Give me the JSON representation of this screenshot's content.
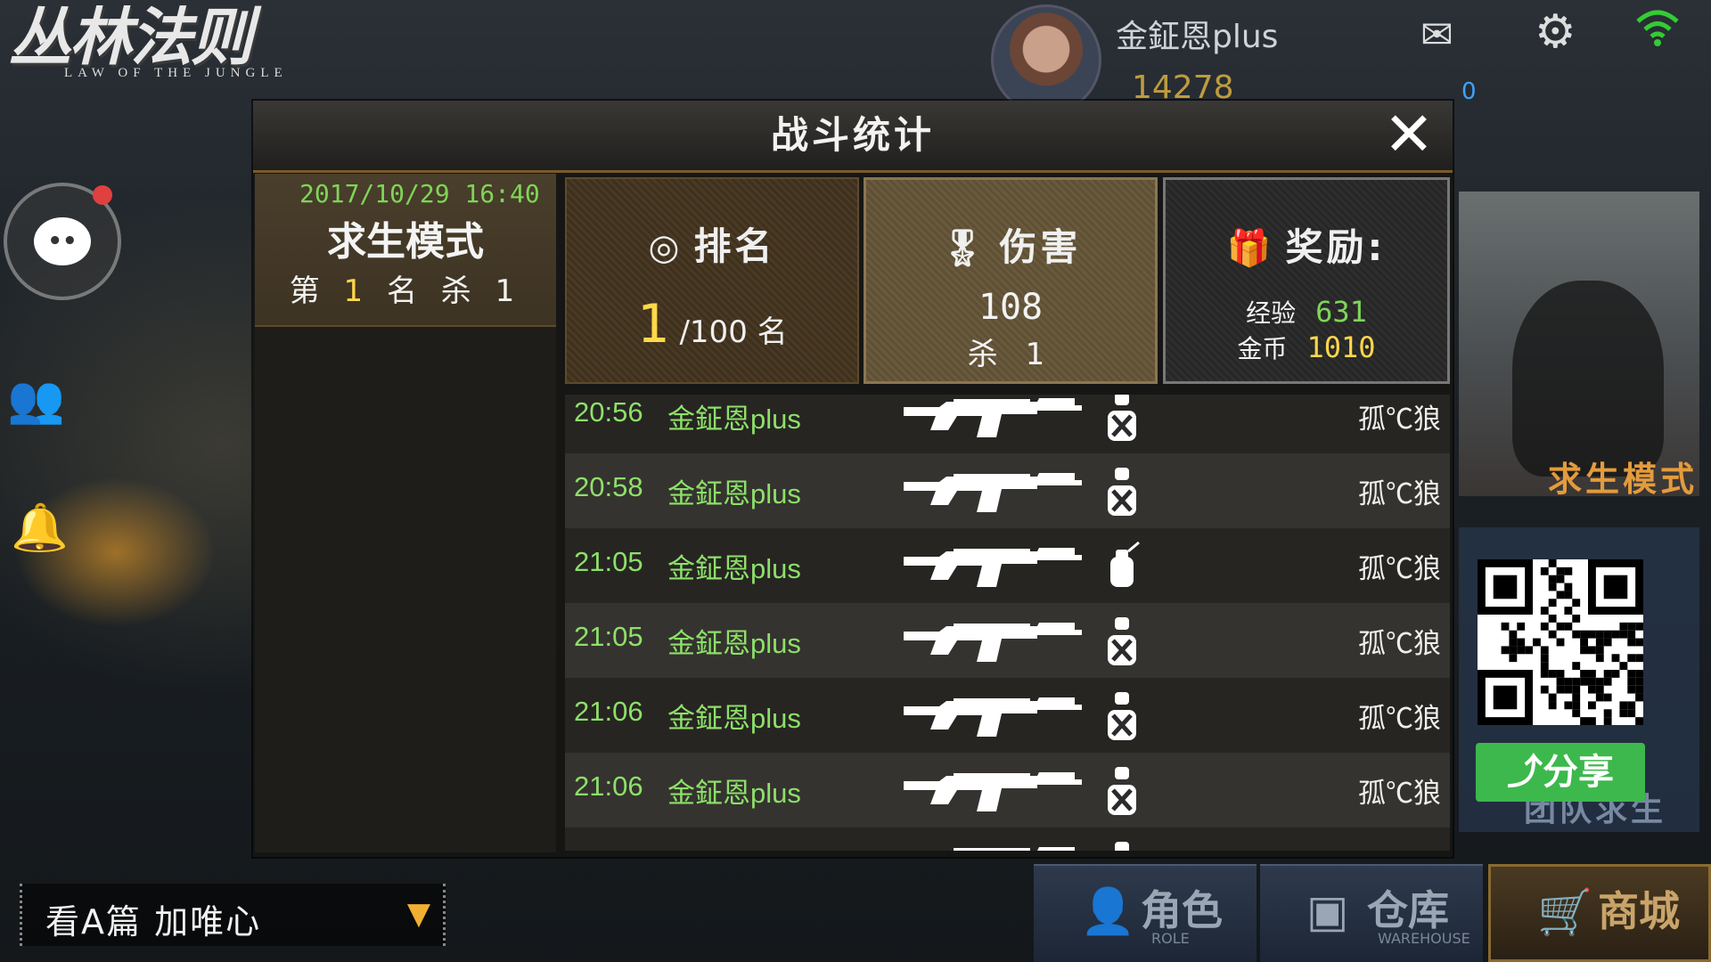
{
  "header": {
    "logo_cn": "丛林法则",
    "logo_en": "LAW OF THE JUNGLE",
    "username": "金鉦恩plus",
    "coins": "14278",
    "diamonds": "0"
  },
  "panel": {
    "title": "战斗统计",
    "close": "✕",
    "session": {
      "datetime": "2017/10/29 16:40",
      "mode": "求生模式",
      "rank_prefix": "第",
      "rank": "1",
      "rank_mid": "名 杀",
      "kills": "1"
    },
    "rank_card": {
      "title": "排名",
      "value": "1",
      "suffix": "/100 名"
    },
    "damage_card": {
      "title": "伤害",
      "damage": "108",
      "kill_label": "杀 1"
    },
    "reward_card": {
      "title": "奖励:",
      "exp_label": "经验",
      "exp_value": "631",
      "gold_label": "金币",
      "gold_value": "1010"
    },
    "kill_feed": [
      {
        "time": "20:56",
        "player": "金鉦恩plus",
        "victim": "孤℃狼",
        "icon": "knockdown-icon"
      },
      {
        "time": "20:58",
        "player": "金鉦恩plus",
        "victim": "孤℃狼",
        "icon": "knockdown-icon"
      },
      {
        "time": "21:05",
        "player": "金鉦恩plus",
        "victim": "孤℃狼",
        "icon": "kill-icon"
      },
      {
        "time": "21:05",
        "player": "金鉦恩plus",
        "victim": "孤℃狼",
        "icon": "knockdown-icon"
      },
      {
        "time": "21:06",
        "player": "金鉦恩plus",
        "victim": "孤℃狼",
        "icon": "knockdown-icon"
      },
      {
        "time": "21:06",
        "player": "金鉦恩plus",
        "victim": "孤℃狼",
        "icon": "knockdown-icon"
      },
      {
        "time": "",
        "player": "",
        "victim": "",
        "icon": "knockdown-icon"
      }
    ]
  },
  "right": {
    "mode_label": "求生模式",
    "team_label": "团队求生",
    "share": "分享"
  },
  "chat": {
    "text": "看A篇 加唯心"
  },
  "nav": {
    "role": {
      "label": "角色",
      "sub": "ROLE"
    },
    "warehouse": {
      "label": "仓库",
      "sub": "WAREHOUSE"
    },
    "shop": {
      "label": "商城"
    }
  },
  "colors": {
    "accent_green": "#7ed657",
    "accent_gold": "#ffd84a",
    "share_green": "#3db84c"
  }
}
